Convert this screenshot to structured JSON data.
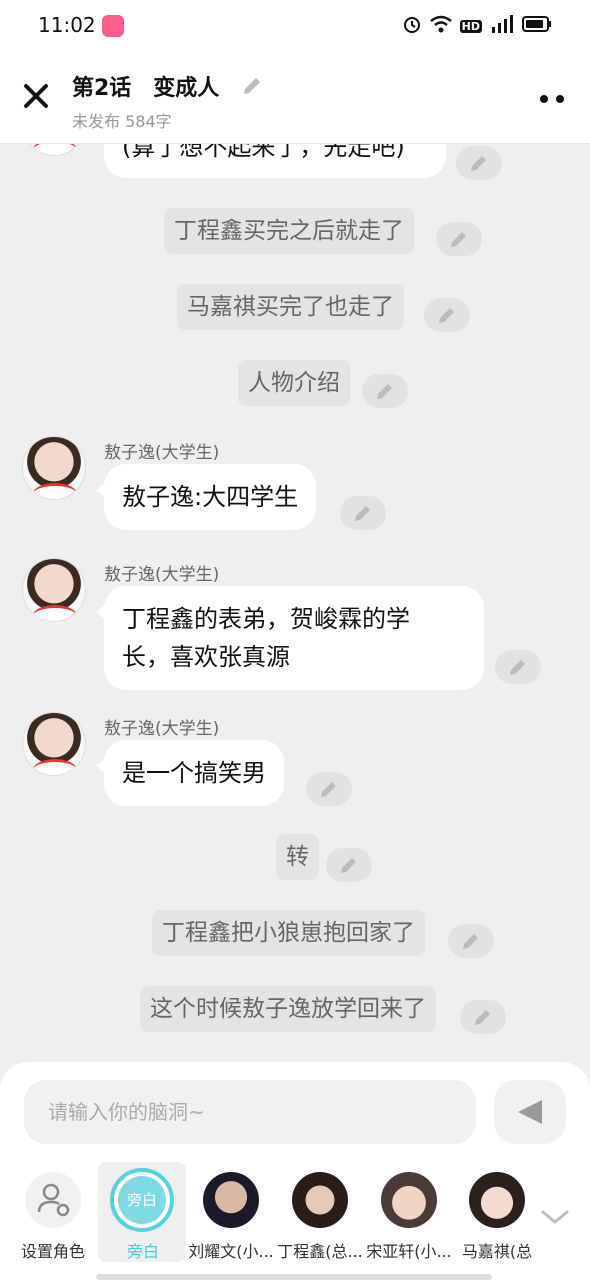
{
  "status_bar": {
    "time": "11:02",
    "network": "4G",
    "hd": "HD"
  },
  "header": {
    "title": "第2话　变成人",
    "subtitle": "未发布 584字"
  },
  "messages": {
    "top_cut": "(算了想不起来了，先走吧)",
    "n1": "丁程鑫买完之后就走了",
    "n2": "马嘉祺买完了也走了",
    "n3": "人物介绍",
    "s1": "敖子逸(大学生)",
    "b1": "敖子逸:大四学生",
    "s2": "敖子逸(大学生)",
    "b2_line1": "丁程鑫的表弟，贺峻霖的学",
    "b2_line2": "长，喜欢张真源",
    "s3": "敖子逸(大学生)",
    "b3": "是一个搞笑男",
    "n4": "转",
    "n5": "丁程鑫把小狼崽抱回家了",
    "n6": "这个时候敖子逸放学回来了"
  },
  "input": {
    "placeholder": "请输入你的脑洞~"
  },
  "roles": {
    "set_role": "设置角色",
    "narrator_badge": "旁白",
    "narrator": "旁白",
    "r1": "刘耀文(小...",
    "r2": "丁程鑫(总...",
    "r3": "宋亚轩(小...",
    "r4": "马嘉祺(总"
  },
  "colors": {
    "accent": "#56d1dc",
    "background": "#efefef",
    "bubble": "#ffffff",
    "narration": "#e4e4e4"
  }
}
